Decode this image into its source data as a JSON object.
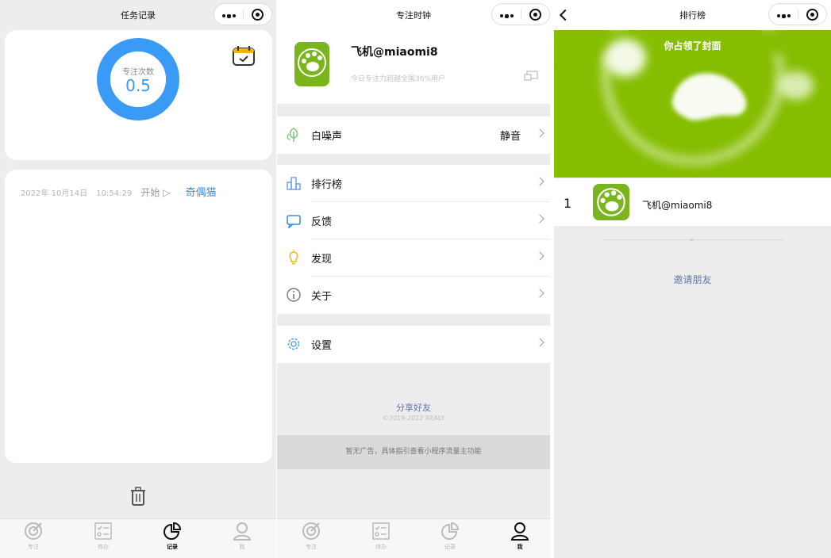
{
  "record_screen": {
    "title": "任务记录",
    "ring_label": "专注次数",
    "ring_value": "0.5",
    "records": [
      {
        "date": "2022年 10月14日",
        "time": "10:54:29",
        "action": "开始 ▷",
        "name": "奇偶猫"
      }
    ],
    "tabs": [
      {
        "label": "专注",
        "icon": "focus-icon"
      },
      {
        "label": "待办",
        "icon": "todo-icon"
      },
      {
        "label": "记录",
        "icon": "records-icon"
      },
      {
        "label": "我",
        "icon": "profile-icon"
      }
    ],
    "active_tab": "记录"
  },
  "profile_screen": {
    "title": "专注时钟",
    "user_name": "飞机@miaomi8",
    "user_subtitle": "今日专注力超越全国36%用户",
    "menu": {
      "white_noise": {
        "label": "白噪声",
        "value": "静音",
        "icon": "tree-icon"
      },
      "ranking": {
        "label": "排行榜",
        "icon": "ranking-icon"
      },
      "feedback": {
        "label": "反馈",
        "icon": "feedback-icon"
      },
      "discover": {
        "label": "发现",
        "icon": "bulb-icon"
      },
      "about": {
        "label": "关于",
        "icon": "info-icon"
      },
      "settings": {
        "label": "设置",
        "icon": "gear-icon"
      }
    },
    "share_label": "分享好友",
    "copyright": "©2019-2022 REALY",
    "ad_text": "暂无广告，具体指引查看小程序流量主功能",
    "tabs": [
      {
        "label": "专注"
      },
      {
        "label": "待办"
      },
      {
        "label": "记录"
      },
      {
        "label": "我"
      }
    ],
    "active_tab": "我"
  },
  "ranking_screen": {
    "title": "排行榜",
    "banner_text": "你占领了封面",
    "entries": [
      {
        "rank": "1",
        "name": "飞机@miaomi8"
      }
    ],
    "invite_label": "邀请朋友"
  },
  "colors": {
    "accent_blue": "#3a9bf6",
    "brand_green": "#85bd00",
    "link_blue": "#5f77a8"
  }
}
